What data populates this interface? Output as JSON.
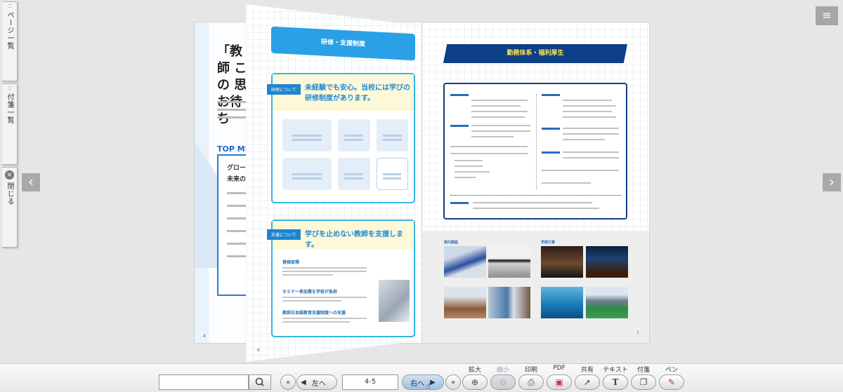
{
  "side_tabs": {
    "pages_label": "ページ一覧",
    "notes_label": "付箋一覧",
    "close_label": "閉じる",
    "close_glyph": "×"
  },
  "nav": {
    "prev_glyph": "‹",
    "next_glyph": "›",
    "menu_glyph": "≡"
  },
  "left_page": {
    "heading": "「教師 この 思 お待ち",
    "section_label": "TOP MES",
    "box_lines": [
      "グロー",
      "未来の"
    ],
    "page_number": "4"
  },
  "flip_page": {
    "ribbon_title": "研修・支援制度",
    "box1": {
      "tag": "研修について",
      "title": "未経験でも安心。当校には学びの研修制度があります。"
    },
    "box2": {
      "tag": "支援について",
      "title": "学びを止めない教師を支援します。",
      "items": [
        "資格取得",
        "セミナー参加費を学校が負担",
        "教師日本語教育支援制度への支援"
      ]
    },
    "page_number": "6"
  },
  "right_page": {
    "ribbon_title": "勤務体系・福利厚生",
    "gallery_labels": [
      "校内施設",
      "学校行事"
    ],
    "page_number": "7"
  },
  "toolbar": {
    "search_value": "",
    "search_icon": "search-icon",
    "prev_label": "左へ",
    "page_value": "4-5",
    "next_label": "右へ",
    "tools": [
      {
        "label": "拡大",
        "icon": "zoom-in-icon",
        "glyph": "⊕",
        "enabled": true
      },
      {
        "label": "縮小",
        "icon": "zoom-out-icon",
        "glyph": "⊖",
        "enabled": false
      },
      {
        "label": "印刷",
        "icon": "print-icon",
        "glyph": "⎙",
        "enabled": true
      },
      {
        "label": "PDF",
        "icon": "pdf-icon",
        "glyph": "▣",
        "enabled": true
      },
      {
        "label": "共有",
        "icon": "share-icon",
        "glyph": "➚",
        "enabled": true
      },
      {
        "label": "テキスト",
        "icon": "text-icon",
        "glyph": "T",
        "enabled": true
      },
      {
        "label": "付箋",
        "icon": "sticky-note-icon",
        "glyph": "❐",
        "enabled": true
      },
      {
        "label": "ペン",
        "icon": "pen-icon",
        "glyph": "✎",
        "enabled": true
      }
    ]
  }
}
